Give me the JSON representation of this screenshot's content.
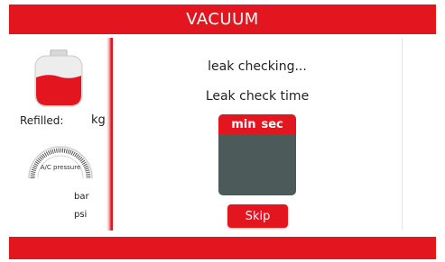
{
  "header": {
    "title": "VACUUM"
  },
  "left_panel": {
    "refilled_label": "Refilled:",
    "refilled_unit": "kg",
    "gauge_label": "A/C pressure",
    "unit_bar": "bar",
    "unit_psi": "psi"
  },
  "center": {
    "status": "leak checking...",
    "time_label": "Leak check time",
    "timer_min_label": "min",
    "timer_sec_label": "sec",
    "skip_label": "Skip"
  },
  "icons": {
    "tank": "refrigerant-tank-icon",
    "gauge": "pressure-gauge-icon"
  },
  "colors": {
    "accent": "#e3151f",
    "timer_background": "#4c5a5a"
  }
}
